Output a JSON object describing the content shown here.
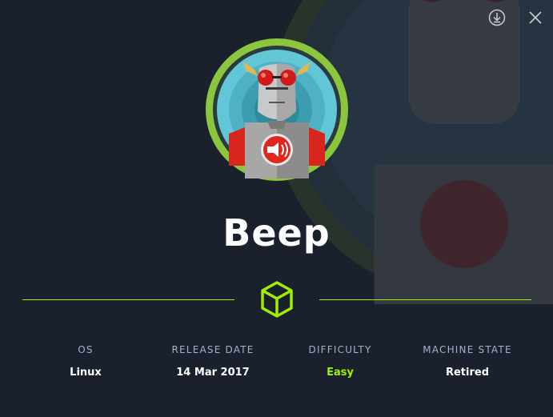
{
  "machine": {
    "name": "Beep"
  },
  "toolbar": {
    "download_icon": "download-icon",
    "close_icon": "close-icon"
  },
  "colors": {
    "background": "#1a212c",
    "accent": "#9fef00",
    "label": "#a4b1cd",
    "value": "#ffffff"
  },
  "info": [
    {
      "label": "OS",
      "value": "Linux"
    },
    {
      "label": "RELEASE DATE",
      "value": "14 Mar 2017"
    },
    {
      "label": "DIFFICULTY",
      "value": "Easy"
    },
    {
      "label": "MACHINE STATE",
      "value": "Retired"
    }
  ]
}
